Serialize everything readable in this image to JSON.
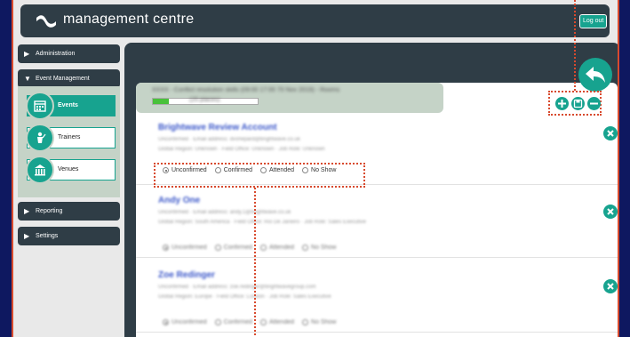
{
  "header": {
    "brand": "management centre",
    "logout_label": "Log out",
    "logo_icon": "ribbon-logo-icon"
  },
  "sidebar": {
    "items": [
      {
        "label": "Administration",
        "state": "collapsed"
      },
      {
        "label": "Event Management",
        "state": "expanded"
      },
      {
        "label": "Reporting",
        "state": "collapsed"
      },
      {
        "label": "Settings",
        "state": "collapsed"
      }
    ],
    "sub_items": [
      {
        "label": "Events",
        "icon": "calendar-icon",
        "active": true
      },
      {
        "label": "Trainers",
        "icon": "trainer-icon",
        "active": false
      },
      {
        "label": "Venues",
        "icon": "venue-building-icon",
        "active": false
      }
    ]
  },
  "event": {
    "title": "XXXX - Conflict resolution skills (09:00 17:00 70 Nov 2019) - Rooms",
    "count": "(25 places)",
    "progress": 0.15
  },
  "attendees": [
    {
      "name": "Brightwave Review Account",
      "line1": "Unconfirmed · Email address: dvshepard@brightwave.co.uk",
      "line2": "Global Region: Unknown · Field Office: Unknown · Job Role: Unknown",
      "status_options": [
        "Unconfirmed",
        "Confirmed",
        "Attended",
        "No Show"
      ],
      "selected": "Unconfirmed"
    },
    {
      "name": "Andy One",
      "line1": "Unconfirmed · Email address: andy.1@brightwave.co.uk",
      "line2": "Global Region: South America · Field Office: Rio De Janeiro · Job Role: Sales Executive",
      "status_options": [
        "Unconfirmed",
        "Confirmed",
        "Attended",
        "No Show"
      ],
      "selected": "Unconfirmed"
    },
    {
      "name": "Zoe Redinger",
      "line1": "Unconfirmed · Email address: zoe.redinger@brightwavegroup.com",
      "line2": "Global Region: Europe · Field Office: London · Job Role: Sales Executive",
      "status_options": [
        "Unconfirmed",
        "Confirmed",
        "Attended",
        "No Show"
      ],
      "selected": "Unconfirmed"
    }
  ],
  "colors": {
    "accent": "#17a38f",
    "dark": "#2f3d46",
    "highlight": "#d84a2e",
    "background": "#0e1860"
  }
}
